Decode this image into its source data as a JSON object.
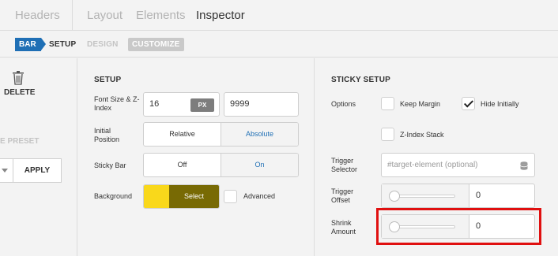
{
  "top_tabs": {
    "headers": "Headers",
    "layout": "Layout",
    "elements": "Elements",
    "inspector": "Inspector"
  },
  "sub_tabs": {
    "bar": "BAR",
    "setup": "SETUP",
    "design": "DESIGN",
    "customize": "CUSTOMIZE"
  },
  "left_panel": {
    "delete_label": "DELETE",
    "preset_label": "E PRESET",
    "apply_label": "APPLY",
    "trash_icon": "trash-icon"
  },
  "setup": {
    "title": "SETUP",
    "font_size_label": "Font Size & Z-Index",
    "font_size_value": "16",
    "font_size_unit": "PX",
    "z_index_value": "9999",
    "initial_position_label": "Initial Position",
    "position_options": [
      "Relative",
      "Absolute"
    ],
    "position_selected": "Absolute",
    "sticky_bar_label": "Sticky Bar",
    "sticky_options": [
      "Off",
      "On"
    ],
    "sticky_selected": "On",
    "background_label": "Background",
    "background_color": "#f9d81b",
    "select_label": "Select",
    "advanced_label": "Advanced",
    "advanced_checked": false
  },
  "sticky_setup": {
    "title": "STICKY SETUP",
    "options_label": "Options",
    "keep_margin_label": "Keep Margin",
    "keep_margin_checked": false,
    "hide_initially_label": "Hide Initially",
    "hide_initially_checked": true,
    "z_index_stack_label": "Z-Index Stack",
    "z_index_stack_checked": false,
    "trigger_selector_label": "Trigger Selector",
    "trigger_selector_placeholder": "#target-element (optional)",
    "database_icon": "database-icon",
    "trigger_offset_label": "Trigger Offset",
    "trigger_offset_value": "0",
    "shrink_amount_label": "Shrink Amount",
    "shrink_amount_value": "0"
  },
  "colors": {
    "accent": "#1f6fb5",
    "swatch": "#f9d81b",
    "select_button": "#786a04",
    "highlight": "#e01010"
  }
}
